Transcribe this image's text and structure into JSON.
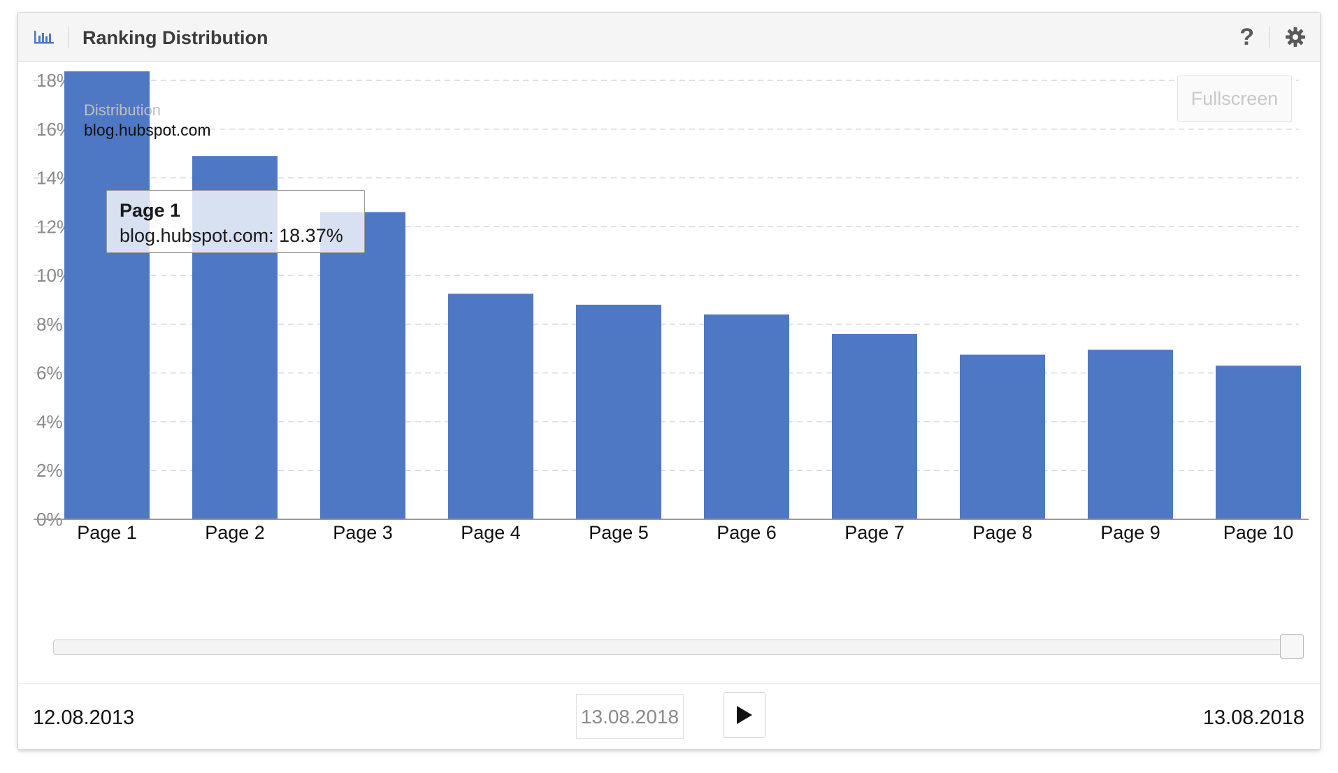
{
  "header": {
    "title": "Ranking Distribution",
    "icon": "bar-chart-icon",
    "help_label": "?",
    "settings_icon": "gear-icon"
  },
  "plot": {
    "fullscreen_label": "Fullscreen",
    "legend_title": "Distribution",
    "legend_item": "blog.hubspot.com",
    "tooltip": {
      "title": "Page 1",
      "body": "blog.hubspot.com: 18.37%"
    }
  },
  "footer": {
    "start_date": "12.08.2013",
    "current_date": "13.08.2018",
    "end_date": "13.08.2018",
    "play_icon": "play-icon"
  },
  "colors": {
    "bar": "#4f78c4",
    "grid": "#d6d6d6",
    "axis": "#999999"
  },
  "chart_data": {
    "type": "bar",
    "categories": [
      "Page 1",
      "Page 2",
      "Page 3",
      "Page 4",
      "Page 5",
      "Page 6",
      "Page 7",
      "Page 8",
      "Page 9",
      "Page 10"
    ],
    "series": [
      {
        "name": "blog.hubspot.com",
        "values": [
          18.37,
          14.9,
          12.6,
          9.25,
          8.8,
          8.4,
          7.6,
          6.75,
          6.95,
          6.3
        ]
      }
    ],
    "yticks": [
      "0%",
      "2%",
      "4%",
      "6%",
      "8%",
      "10%",
      "12%",
      "14%",
      "16%",
      "18%"
    ],
    "ylim": [
      0,
      18
    ],
    "legend": "top-left",
    "grid": true
  }
}
